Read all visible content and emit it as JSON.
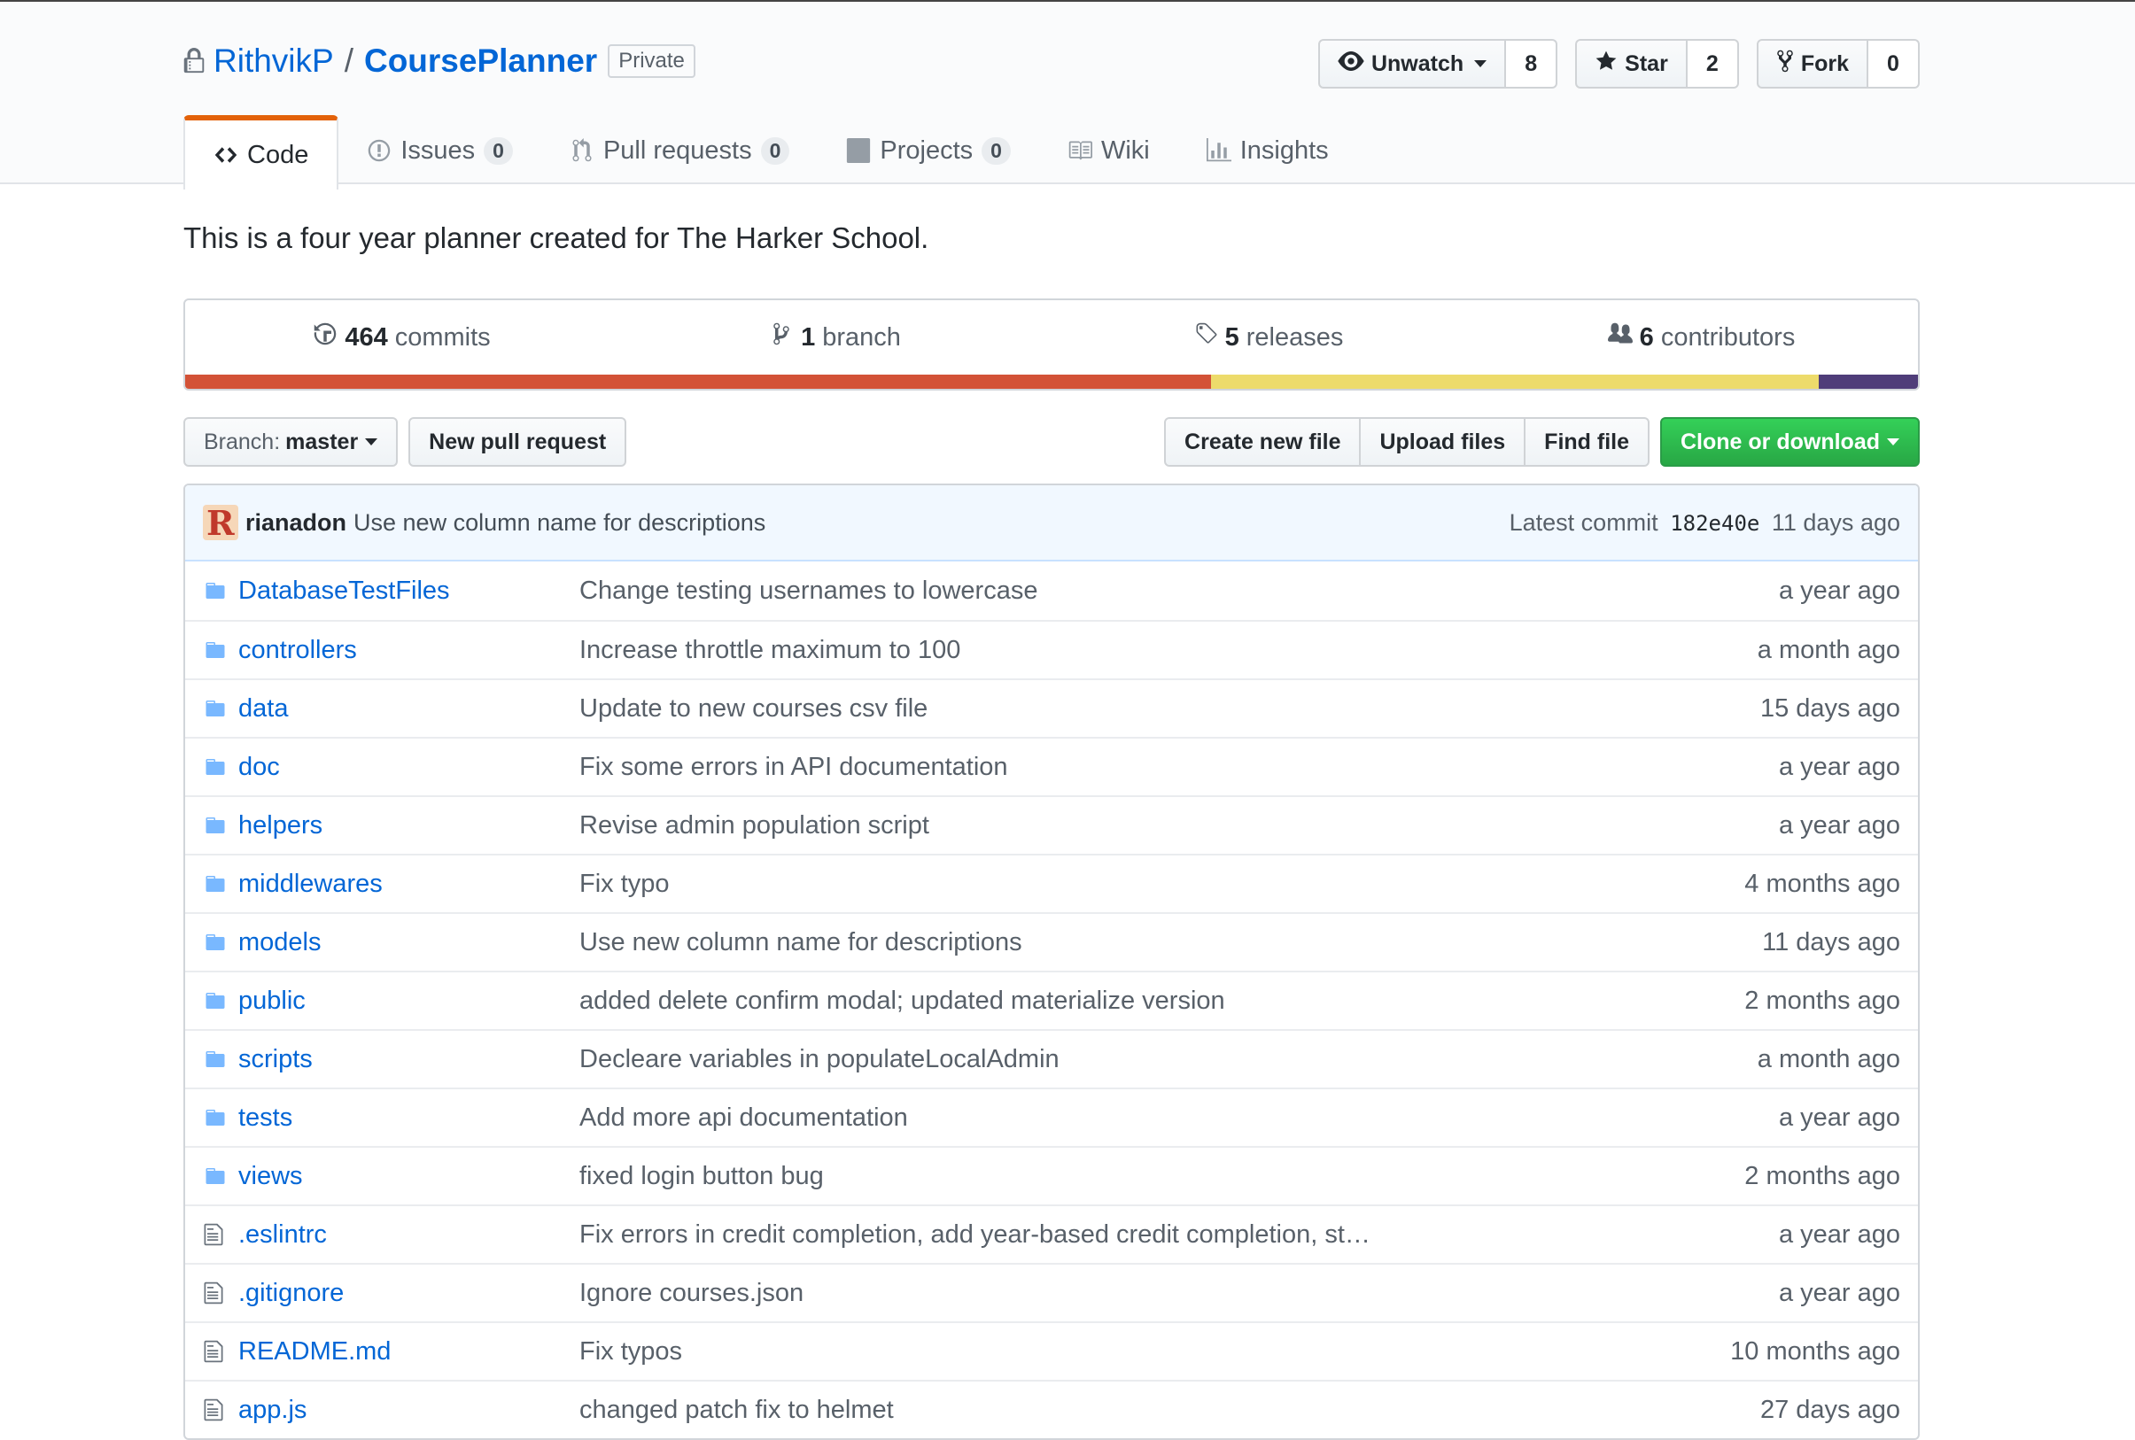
{
  "repo": {
    "owner": "RithvikP",
    "separator": "/",
    "name": "CoursePlanner",
    "visibility": "Private"
  },
  "actions": {
    "watch_label": "Unwatch",
    "watch_count": "8",
    "star_label": "Star",
    "star_count": "2",
    "fork_label": "Fork",
    "fork_count": "0"
  },
  "tabs": [
    {
      "label": "Code",
      "icon": "code-icon"
    },
    {
      "label": "Issues",
      "count": "0",
      "icon": "issue-icon"
    },
    {
      "label": "Pull requests",
      "count": "0",
      "icon": "pull-request-icon"
    },
    {
      "label": "Projects",
      "count": "0",
      "icon": "project-icon"
    },
    {
      "label": "Wiki",
      "icon": "book-icon"
    },
    {
      "label": "Insights",
      "icon": "graph-icon"
    }
  ],
  "description": "This is a four year planner created for The Harker School.",
  "summary": {
    "commits_count": "464",
    "commits_label": "commits",
    "branches_count": "1",
    "branches_label": "branch",
    "releases_count": "5",
    "releases_label": "releases",
    "contributors_count": "6",
    "contributors_label": "contributors"
  },
  "languages": [
    {
      "color": "#d35237",
      "share": 59.2
    },
    {
      "color": "#eddb6b",
      "share": 35.1
    },
    {
      "color": "#4f3d79",
      "share": 5.7
    }
  ],
  "filenav": {
    "branch_prefix": "Branch:",
    "branch_name": "master",
    "new_pr": "New pull request",
    "create_file": "Create new file",
    "upload": "Upload files",
    "find": "Find file",
    "clone": "Clone or download"
  },
  "commit": {
    "avatar_letter": "R",
    "author": "rianadon",
    "message": "Use new column name for descriptions",
    "prefix": "Latest commit",
    "sha": "182e40e",
    "age": "11 days ago"
  },
  "files": [
    {
      "type": "dir",
      "name": "DatabaseTestFiles",
      "message": "Change testing usernames to lowercase",
      "age": "a year ago"
    },
    {
      "type": "dir",
      "name": "controllers",
      "message": "Increase throttle maximum to 100",
      "age": "a month ago"
    },
    {
      "type": "dir",
      "name": "data",
      "message": "Update to new courses csv file",
      "age": "15 days ago"
    },
    {
      "type": "dir",
      "name": "doc",
      "message": "Fix some errors in API documentation",
      "age": "a year ago"
    },
    {
      "type": "dir",
      "name": "helpers",
      "message": "Revise admin population script",
      "age": "a year ago"
    },
    {
      "type": "dir",
      "name": "middlewares",
      "message": "Fix typo",
      "age": "4 months ago"
    },
    {
      "type": "dir",
      "name": "models",
      "message": "Use new column name for descriptions",
      "age": "11 days ago"
    },
    {
      "type": "dir",
      "name": "public",
      "message": "added delete confirm modal; updated materialize version",
      "age": "2 months ago"
    },
    {
      "type": "dir",
      "name": "scripts",
      "message": "Decleare variables in populateLocalAdmin",
      "age": "a month ago"
    },
    {
      "type": "dir",
      "name": "tests",
      "message": "Add more api documentation",
      "age": "a year ago"
    },
    {
      "type": "dir",
      "name": "views",
      "message": "fixed login button bug",
      "age": "2 months ago"
    },
    {
      "type": "file",
      "name": ".eslintrc",
      "message": "Fix errors in credit completion, add year-based credit completion, st…",
      "age": "a year ago"
    },
    {
      "type": "file",
      "name": ".gitignore",
      "message": "Ignore courses.json",
      "age": "a year ago"
    },
    {
      "type": "file",
      "name": "README.md",
      "message": "Fix typos",
      "age": "10 months ago"
    },
    {
      "type": "file",
      "name": "app.js",
      "message": "changed patch fix to helmet",
      "age": "27 days ago"
    }
  ]
}
